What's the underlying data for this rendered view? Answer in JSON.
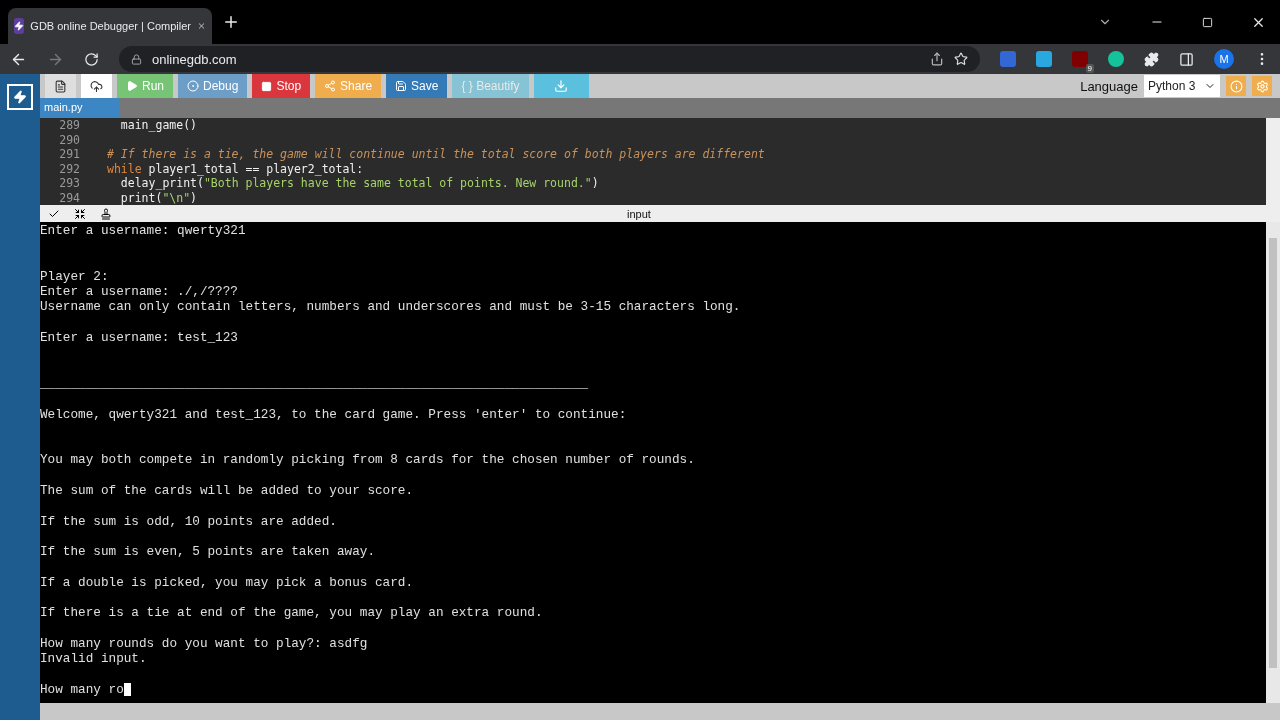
{
  "browser": {
    "tab": {
      "title": "GDB online Debugger | Compiler"
    },
    "address": "onlinegdb.com",
    "extension_badge": "9",
    "profile_initial": "M"
  },
  "toolbar": {
    "buttons": [
      {
        "kind": "new",
        "disabled": false
      },
      {
        "kind": "upload",
        "disabled": false
      },
      {
        "kind": "run",
        "label": "Run",
        "disabled": false
      },
      {
        "kind": "debug",
        "label": "Debug",
        "disabled": false
      },
      {
        "kind": "stop",
        "label": "Stop",
        "disabled": false
      },
      {
        "kind": "share",
        "label": "Share",
        "disabled": false
      },
      {
        "kind": "save",
        "label": "Save",
        "disabled": false
      },
      {
        "kind": "beautify",
        "label": "{ } Beautify",
        "disabled": true
      },
      {
        "kind": "download",
        "disabled": false
      }
    ],
    "language_label": "Language",
    "language": "Python 3"
  },
  "file_tabs": [
    {
      "label": "main.py",
      "selected": true
    }
  ],
  "editor": {
    "lines": [
      {
        "number": "289",
        "kind": "code",
        "text": "  main_game()"
      },
      {
        "number": "290",
        "kind": "blank"
      },
      {
        "number": "291",
        "kind": "comment",
        "text": "# If there is a tie, the game will continue until the total score of both players are different"
      },
      {
        "number": "292",
        "kind": "while",
        "text": "player1_total == player2_total:"
      },
      {
        "number": "293",
        "kind": "call",
        "text": "delay_print(",
        "string": "\"Both players have the same total of points. New round.\"",
        "close": ")"
      },
      {
        "number": "294",
        "kind": "call",
        "text": "print(",
        "string": "\"\\n\"",
        "close": ")"
      }
    ]
  },
  "console": {
    "title": "input",
    "lines": [
      {
        "kind": "text",
        "text": "Enter a username: qwerty321"
      },
      {
        "kind": "blank"
      },
      {
        "kind": "blank"
      },
      {
        "kind": "text",
        "text": "Player 2:"
      },
      {
        "kind": "text",
        "text": "Enter a username: ./,/????"
      },
      {
        "kind": "text",
        "text": "Username can only contain letters, numbers and underscores and must be 3-15 characters long."
      },
      {
        "kind": "blank"
      },
      {
        "kind": "text",
        "text": "Enter a username: test_123"
      },
      {
        "kind": "blank"
      },
      {
        "kind": "blank"
      },
      {
        "kind": "text",
        "text": "________________________________________________________________________"
      },
      {
        "kind": "blank"
      },
      {
        "kind": "text",
        "text": "Welcome, qwerty321 and test_123, to the card game. Press 'enter' to continue:"
      },
      {
        "kind": "blank"
      },
      {
        "kind": "blank"
      },
      {
        "kind": "text",
        "text": "You may both compete in randomly picking from 8 cards for the chosen number of rounds."
      },
      {
        "kind": "blank"
      },
      {
        "kind": "text",
        "text": "The sum of the cards will be added to your score."
      },
      {
        "kind": "blank"
      },
      {
        "kind": "text",
        "text": "If the sum is odd, 10 points are added."
      },
      {
        "kind": "blank"
      },
      {
        "kind": "text",
        "text": "If the sum is even, 5 points are taken away."
      },
      {
        "kind": "blank"
      },
      {
        "kind": "text",
        "text": "If a double is picked, you may pick a bonus card."
      },
      {
        "kind": "blank"
      },
      {
        "kind": "text",
        "text": "If there is a tie at end of the game, you may play an extra round."
      },
      {
        "kind": "blank"
      },
      {
        "kind": "text",
        "text": "How many rounds do you want to play?: asdfg"
      },
      {
        "kind": "text",
        "text": "Invalid input."
      },
      {
        "kind": "blank"
      },
      {
        "kind": "prompt",
        "text": "How many ro"
      }
    ]
  }
}
